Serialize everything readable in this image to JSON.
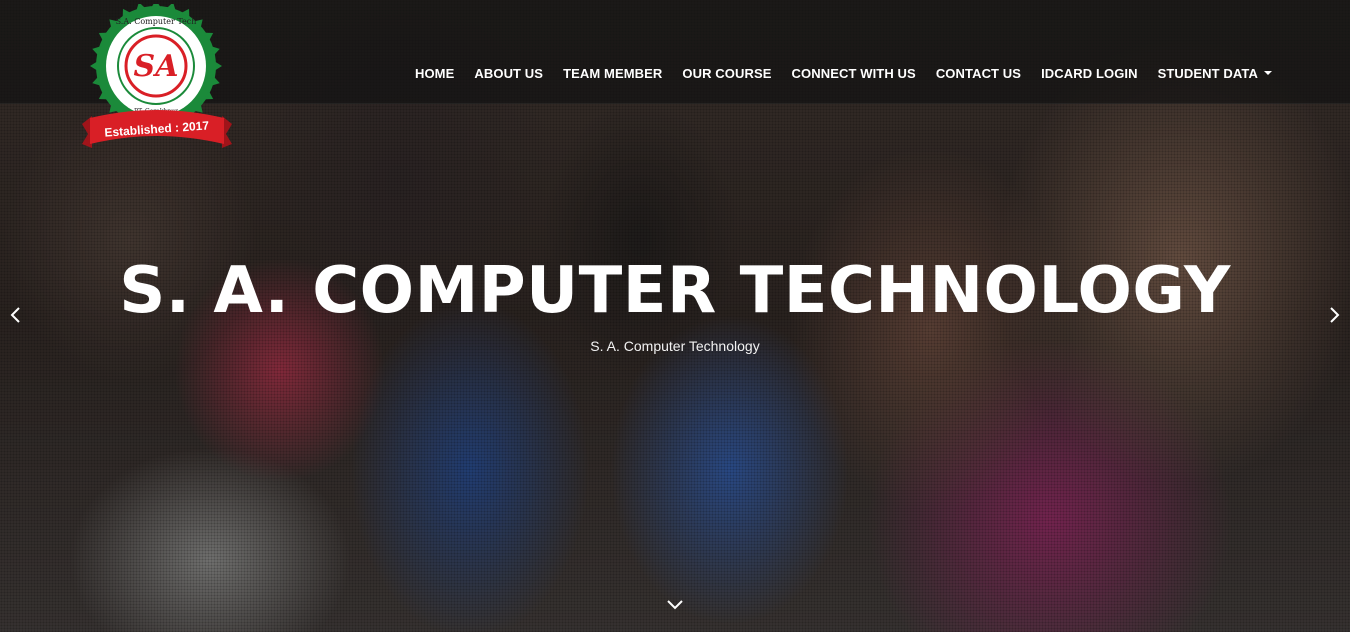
{
  "logo": {
    "initials": "SA",
    "ring_text": "S.A. Computer Technology",
    "sub_text": "PT. Gorakhpur",
    "ribbon": "Established : 2017",
    "colors": {
      "ring": "#1b8a3a",
      "ribbon": "#d91f26",
      "letters": "#d91f26"
    }
  },
  "nav": {
    "items": [
      {
        "label": "HOME"
      },
      {
        "label": "ABOUT US"
      },
      {
        "label": "TEAM MEMBER"
      },
      {
        "label": "OUR COURSE"
      },
      {
        "label": "CONNECT WITH US"
      },
      {
        "label": "CONTACT US"
      },
      {
        "label": "IDCARD LOGIN"
      },
      {
        "label": "STUDENT DATA",
        "dropdown": true
      }
    ]
  },
  "hero": {
    "title": "S. A. COMPUTER TECHNOLOGY",
    "subtitle": "S. A. Computer Technology"
  },
  "icons": {
    "prev": "chevron-left-icon",
    "next": "chevron-right-icon",
    "scroll": "chevron-down-icon"
  }
}
